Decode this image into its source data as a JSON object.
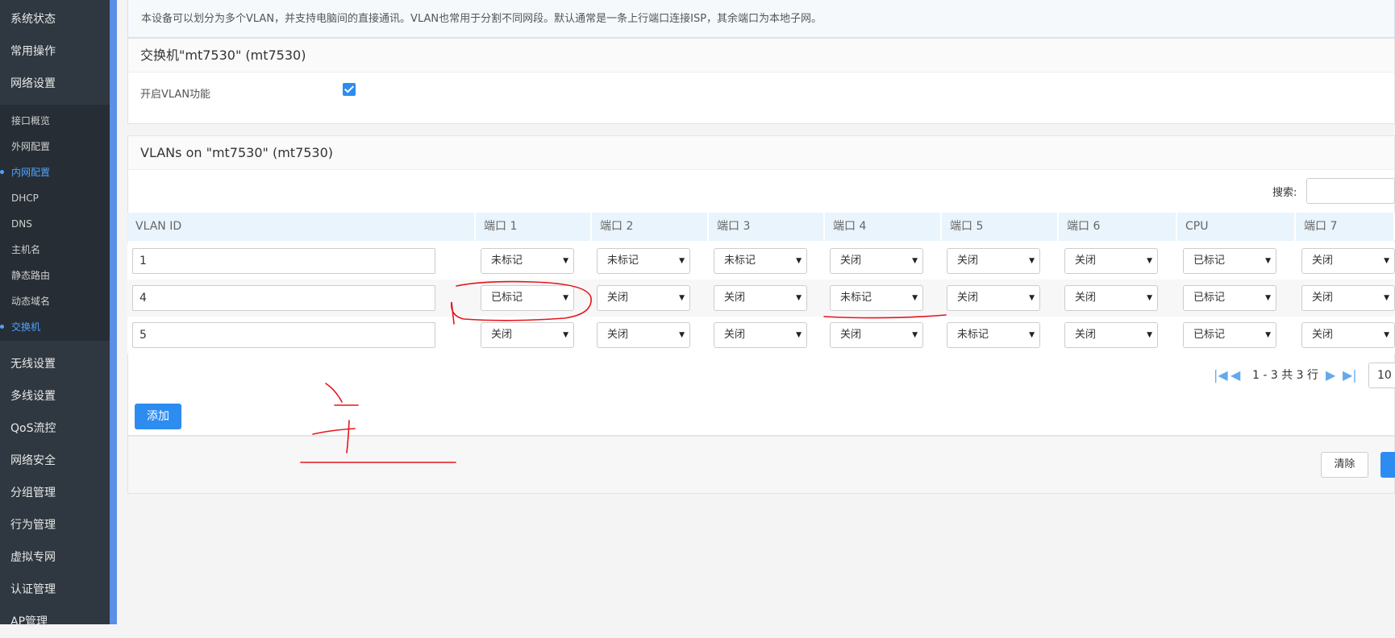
{
  "sidebar": {
    "top_items": [
      "系统状态",
      "常用操作",
      "网络设置"
    ],
    "sub_items": [
      {
        "label": "接口概览",
        "active": false
      },
      {
        "label": "外网配置",
        "active": false
      },
      {
        "label": "内网配置",
        "active": true
      },
      {
        "label": "DHCP",
        "active": false
      },
      {
        "label": "DNS",
        "active": false
      },
      {
        "label": "主机名",
        "active": false
      },
      {
        "label": "静态路由",
        "active": false
      },
      {
        "label": "动态域名",
        "active": false
      },
      {
        "label": "交换机",
        "active": true
      }
    ],
    "bottom_items": [
      "无线设置",
      "多线设置",
      "QoS流控",
      "网络安全",
      "分组管理",
      "行为管理",
      "虚拟专网",
      "认证管理",
      "AP管理"
    ]
  },
  "intro_text": "本设备可以划分为多个VLAN，并支持电脑间的直接通讯。VLAN也常用于分割不同网段。默认通常是一条上行端口连接ISP，其余端口为本地子网。",
  "switch_panel": {
    "title": "交换机\"mt7530\" (mt7530)",
    "enable_vlan_label": "开启VLAN功能",
    "enable_vlan_checked": true
  },
  "vlan_panel": {
    "title": "VLANs on \"mt7530\" (mt7530)",
    "search_label": "搜索:",
    "columns": [
      "VLAN ID",
      "端口 1",
      "端口 2",
      "端口 3",
      "端口 4",
      "端口 5",
      "端口 6",
      "CPU",
      "端口 7"
    ],
    "rows": [
      {
        "vlan_id": "1",
        "ports": [
          "未标记",
          "未标记",
          "未标记",
          "关闭",
          "关闭",
          "关闭",
          "已标记",
          "关闭"
        ]
      },
      {
        "vlan_id": "4",
        "ports": [
          "已标记",
          "关闭",
          "关闭",
          "未标记",
          "关闭",
          "关闭",
          "已标记",
          "关闭"
        ]
      },
      {
        "vlan_id": "5",
        "ports": [
          "关闭",
          "关闭",
          "关闭",
          "关闭",
          "未标记",
          "关闭",
          "已标记",
          "关闭"
        ]
      }
    ],
    "pagination_text": "1 - 3 共 3 行",
    "page_size": "10",
    "add_button": "添加"
  },
  "footer": {
    "clear_button": "清除"
  },
  "colors": {
    "sidebar_bg": "#2f3840",
    "accent_blue": "#2d8cf0",
    "active_nav": "#4fa3ff",
    "table_header_bg": "#e9f4fc",
    "annotation_red": "#e8131b"
  }
}
